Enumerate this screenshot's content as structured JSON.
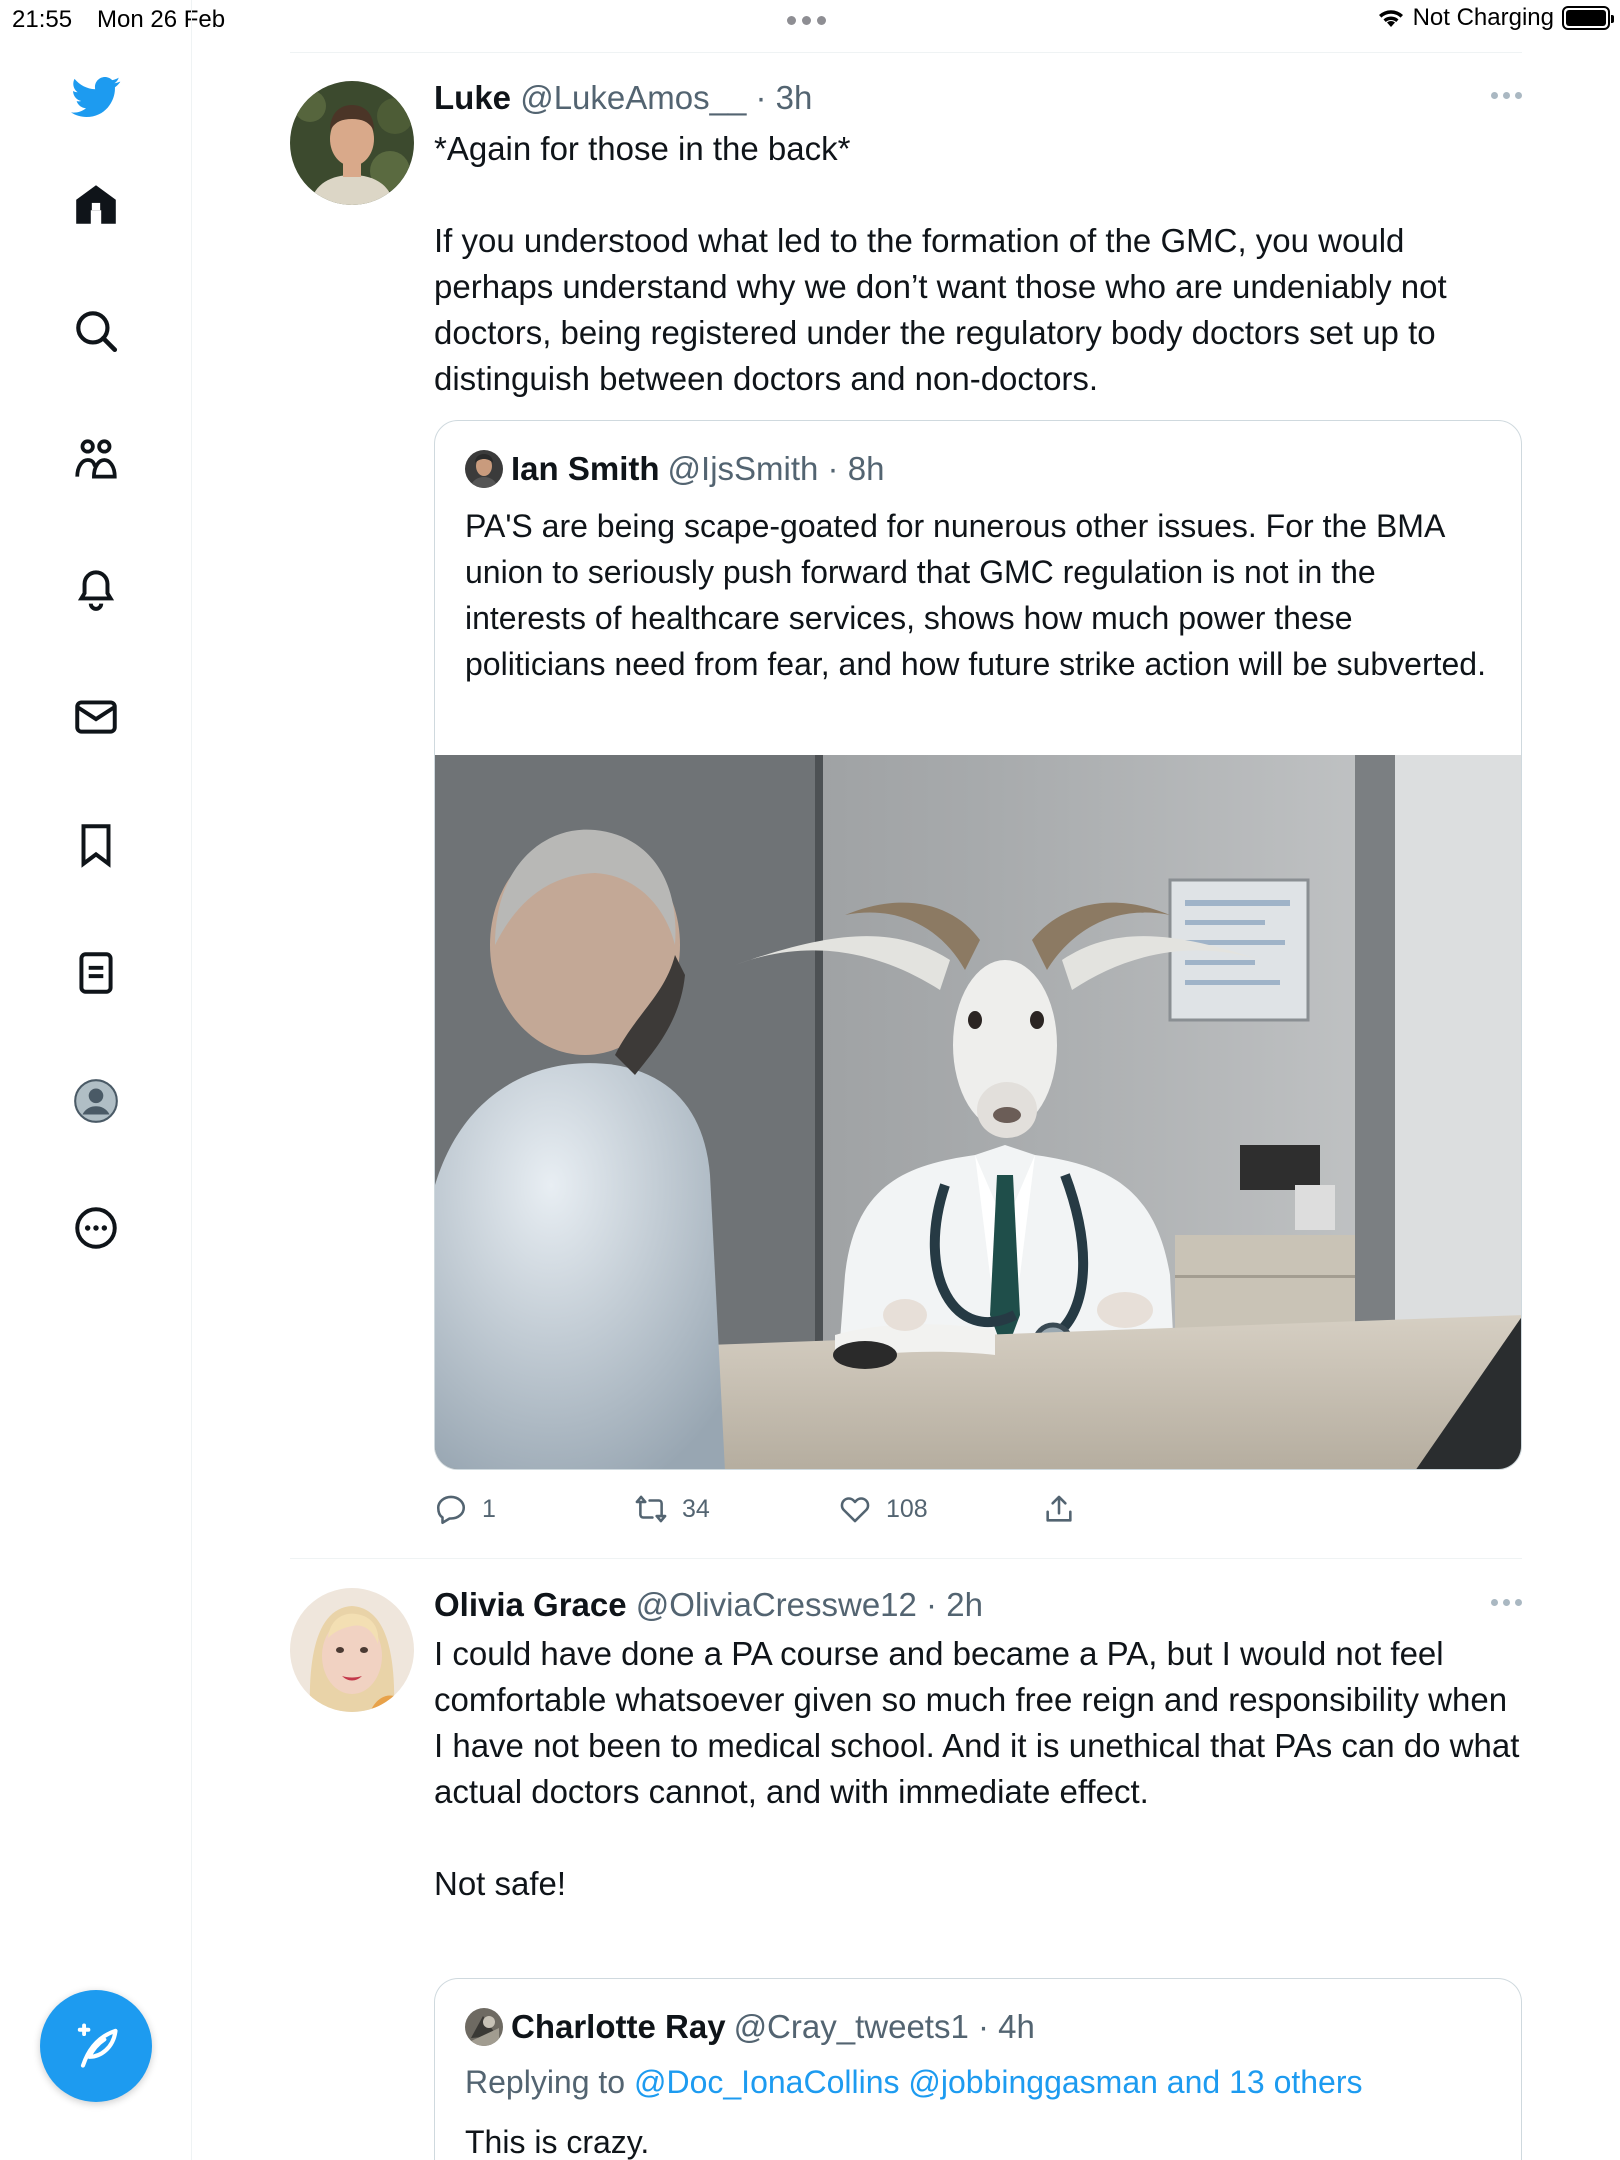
{
  "status_bar": {
    "time": "21:55",
    "date": "Mon 26 Feb",
    "charging": "Not Charging",
    "battery_level": 1.0
  },
  "sidebar": {
    "items": [
      {
        "icon": "twitter-bird-icon"
      },
      {
        "icon": "home-icon"
      },
      {
        "icon": "search-icon"
      },
      {
        "icon": "communities-icon"
      },
      {
        "icon": "bell-icon"
      },
      {
        "icon": "mail-icon"
      },
      {
        "icon": "bookmark-icon"
      },
      {
        "icon": "lists-icon"
      },
      {
        "icon": "profile-icon"
      },
      {
        "icon": "more-circle-icon"
      }
    ],
    "compose_icon": "compose-tweet-icon"
  },
  "colors": {
    "accent": "#1d9bf0",
    "text": "#0f1419",
    "muted": "#536471",
    "border": "#cfd9de"
  },
  "tweets": [
    {
      "name": "Luke",
      "handle": "@LukeAmos__",
      "dot": "·",
      "time": "3h",
      "text": "*Again for those in the back*\n\nIf you understood what led to the formation of the GMC, you would perhaps understand why we don’t want those who are undeniably not doctors, being registered under the regulatory body doctors set up to distinguish between doctors and non-doctors.",
      "quote": {
        "name": "Ian Smith",
        "handle": "@IjsSmith",
        "dot": "·",
        "time": "8h",
        "text": "PA'S are being scape-goated for nunerous other issues. For the BMA union to seriously push forward that GMC regulation is not in the interests of healthcare services, shows how much power these politicians need from fear, and how future strike action will be subverted."
      },
      "actions": {
        "replies": "1",
        "retweets": "34",
        "likes": "108"
      }
    },
    {
      "name": "Olivia Grace",
      "handle": "@OliviaCresswe12",
      "dot": "·",
      "time": "2h",
      "text": "I could have done a PA course and became a PA, but I would not feel comfortable whatsoever given so much free reign and responsibility when I have not been to medical school. And it is unethical that PAs can do what actual doctors cannot, and with immediate effect.\n\nNot safe!",
      "quote": {
        "name": "Charlotte Ray",
        "handle": "@Cray_tweets1",
        "dot": "·",
        "time": "4h",
        "replying_prefix": "Replying to ",
        "replying_to": "@Doc_IonaCollins @jobbinggasman and 13 others",
        "text": "This is crazy."
      }
    }
  ]
}
